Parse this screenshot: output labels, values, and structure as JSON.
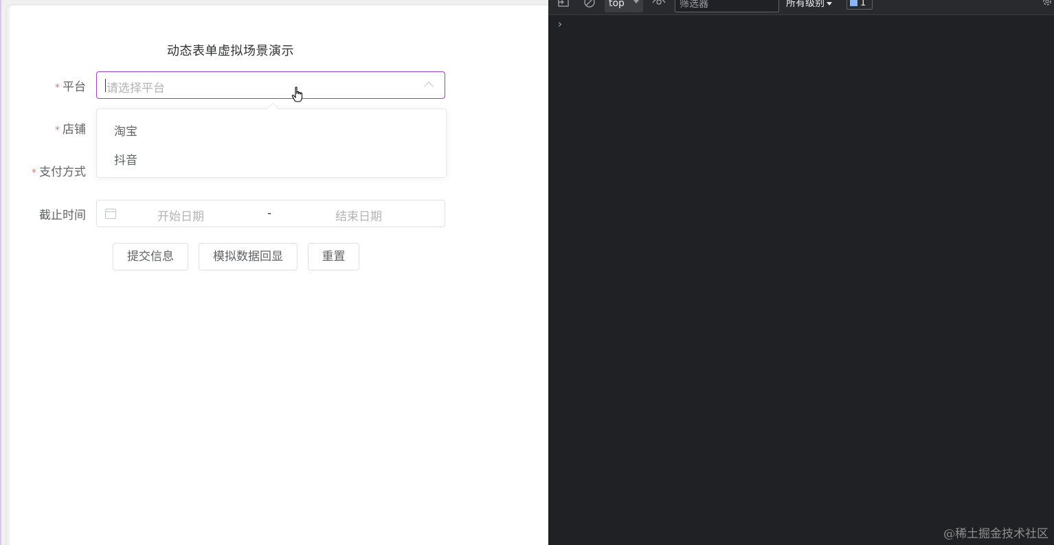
{
  "form": {
    "title": "动态表单虚拟场景演示",
    "platform_label": "平台",
    "platform_placeholder": "请选择平台",
    "shop_label": "店铺",
    "payment_label": "支付方式",
    "deadline_label": "截止时间",
    "required_mark": "*",
    "date_start_placeholder": "开始日期",
    "date_separator": "-",
    "date_end_placeholder": "结束日期",
    "buttons": {
      "submit": "提交信息",
      "mock_data": "模拟数据回显",
      "reset": "重置"
    }
  },
  "dropdown": {
    "options": [
      "淘宝",
      "抖音"
    ]
  },
  "devtools": {
    "context": "top",
    "filter_placeholder": "筛选器",
    "levels": "所有级别",
    "issues_count": "1",
    "prompt": "›",
    "icons": [
      "dock-icon",
      "clear-console-icon",
      "eye-icon",
      "settings-gear-icon"
    ]
  },
  "watermark": "@稀土掘金技术社区",
  "colors": {
    "focus_border": "#9b3ec8",
    "required": "#f56c6c",
    "devtools_bg": "#202124"
  }
}
